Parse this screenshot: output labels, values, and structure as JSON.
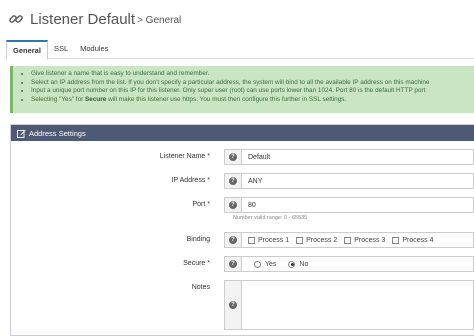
{
  "header": {
    "title": "Listener Default",
    "subtitle": "> General",
    "icon": "link-chain-icon"
  },
  "tabs": [
    {
      "label": "General",
      "active": true
    },
    {
      "label": "SSL",
      "active": false
    },
    {
      "label": "Modules",
      "active": false
    }
  ],
  "info": {
    "lines": [
      "Give listener a name that is easy to understand and remember.",
      "Select an IP address from the list. If you don't specify a particular address, the system will bind to all the available IP address on this machine",
      "Input a unique port number on this IP for this listener. Only super user (root) can use ports lower than 1024. Port 80 is the default HTTP port"
    ],
    "last_prefix": "Selecting \"Yes\" for ",
    "last_bold": "Secure",
    "last_suffix": " will make this listener use https. You must then configure this further in SSL settings."
  },
  "panel": {
    "title": "Address Settings",
    "icon": "edit-icon"
  },
  "form": {
    "listener_name": {
      "label": "Listener Name *",
      "value": "Default"
    },
    "ip_address": {
      "label": "IP Address *",
      "value": "ANY"
    },
    "port": {
      "label": "Port *",
      "value": "80",
      "hint": "Number valid range: 0 - 65535"
    },
    "binding": {
      "label": "Binding",
      "options": [
        "Process 1",
        "Process 2",
        "Process 3",
        "Process 4"
      ]
    },
    "secure": {
      "label": "Secure *",
      "yes": "Yes",
      "no": "No",
      "selected": "No"
    },
    "notes": {
      "label": "Notes",
      "value": ""
    }
  },
  "help_icon": "question-circle-icon"
}
